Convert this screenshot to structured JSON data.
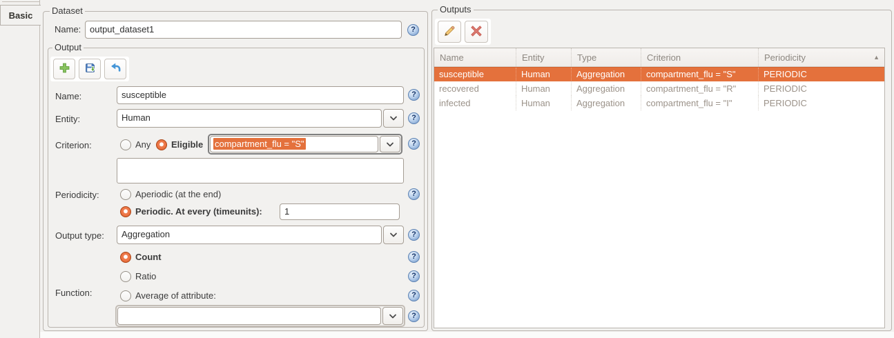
{
  "tab": {
    "basic_label": "Basic"
  },
  "icons": {
    "help_glyph": "?",
    "sort_asc_glyph": "▲"
  },
  "dataset": {
    "group_label": "Dataset",
    "name": {
      "label": "Name:",
      "value": "output_dataset1"
    }
  },
  "output": {
    "group_label": "Output",
    "name": {
      "label": "Name:",
      "value": "susceptible"
    },
    "entity": {
      "label": "Entity:",
      "value": "Human"
    },
    "criterion": {
      "label": "Criterion:",
      "any_label": "Any",
      "eligible_label": "Eligible",
      "value": "compartment_flu = \"S\"",
      "notes_value": ""
    },
    "periodicity": {
      "label": "Periodicity:",
      "aperiodic_label": "Aperiodic (at the end)",
      "periodic_label": "Periodic. At every (timeunits):",
      "periodic_value": "1"
    },
    "output_type": {
      "label": "Output type:",
      "value": "Aggregation"
    },
    "function": {
      "label": "Function:",
      "count_label": "Count",
      "ratio_label": "Ratio",
      "average_label": "Average of attribute:",
      "average_value": ""
    }
  },
  "outputs_panel": {
    "group_label": "Outputs",
    "table": {
      "columns": [
        "Name",
        "Entity",
        "Type",
        "Criterion",
        "Periodicity"
      ],
      "rows": [
        {
          "name": "susceptible",
          "entity": "Human",
          "type": "Aggregation",
          "criterion": "compartment_flu = \"S\"",
          "periodicity": "PERIODIC"
        },
        {
          "name": "recovered",
          "entity": "Human",
          "type": "Aggregation",
          "criterion": "compartment_flu = \"R\"",
          "periodicity": "PERIODIC"
        },
        {
          "name": "infected",
          "entity": "Human",
          "type": "Aggregation",
          "criterion": "compartment_flu = \"I\"",
          "periodicity": "PERIODIC"
        }
      ]
    }
  },
  "colors": {
    "selection_orange": "#e4713c",
    "radio_orange": "#d9551d",
    "help_blue": "#7398c8",
    "background": "#f2f1ef"
  }
}
